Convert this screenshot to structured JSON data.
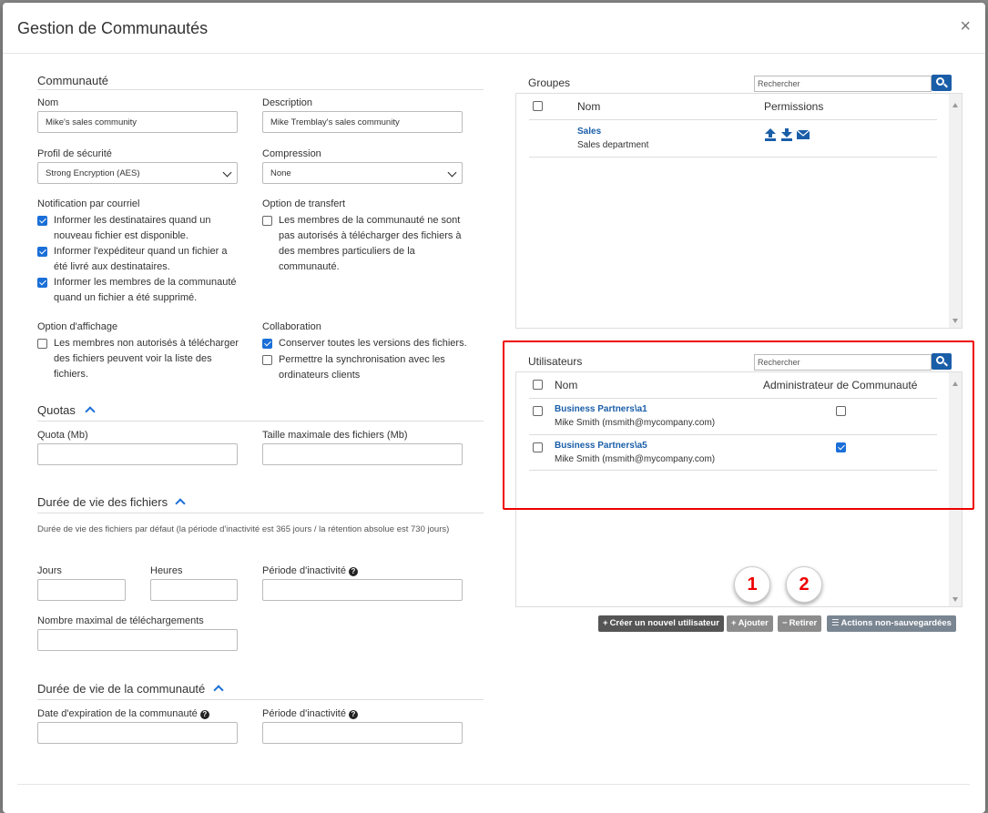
{
  "modal": {
    "title": "Gestion de Communautés",
    "close": "×"
  },
  "communaute": {
    "title": "Communauté",
    "nom_label": "Nom",
    "nom_value": "Mike's sales community",
    "desc_label": "Description",
    "desc_value": "Mike Tremblay's sales community",
    "profil_label": "Profil de sécurité",
    "profil_value": "Strong Encryption (AES)",
    "compression_label": "Compression",
    "compression_value": "None",
    "notif_label": "Notification par courriel",
    "notif_items": [
      {
        "text": "Informer les destinataires quand un nouveau fichier est disponible.",
        "checked": true
      },
      {
        "text": "Informer l'expéditeur quand un fichier a été livré aux destinataires.",
        "checked": true
      },
      {
        "text": "Informer les membres de la communauté quand un fichier a été supprimé.",
        "checked": true
      }
    ],
    "transfert_label": "Option de transfert",
    "transfert_text": "Les membres de la communauté ne sont pas autorisés à télécharger des fichiers à des membres particuliers de la communauté.",
    "affichage_label": "Option d'affichage",
    "affichage_text": "Les membres non autorisés à télécharger des fichiers peuvent voir la liste des fichiers.",
    "collab_label": "Collaboration",
    "collab_items": [
      {
        "text": "Conserver toutes les versions des fichiers.",
        "checked": true
      },
      {
        "text": "Permettre la synchronisation avec les ordinateurs clients",
        "checked": false
      }
    ]
  },
  "quotas": {
    "title": "Quotas",
    "quota_label": "Quota (Mb)",
    "taille_label": "Taille maximale des fichiers (Mb)"
  },
  "duree_fichiers": {
    "title": "Durée de vie des fichiers",
    "note": "Durée de vie des fichiers par défaut (la période d'inactivité est 365 jours / la rétention absolue est 730 jours)",
    "jours_label": "Jours",
    "heures_label": "Heures",
    "inactivite_label": "Période d'inactivité",
    "max_dl_label": "Nombre maximal de téléchargements"
  },
  "duree_communaute": {
    "title": "Durée de vie de la communauté",
    "expiration_label": "Date d'expiration de la communauté",
    "inactivite_label": "Période d'inactivité"
  },
  "groupes": {
    "title": "Groupes",
    "search_placeholder": "Rechercher",
    "col_nom": "Nom",
    "col_permissions": "Permissions",
    "rows": [
      {
        "name": "Sales",
        "desc": "Sales department"
      }
    ]
  },
  "utilisateurs": {
    "title": "Utilisateurs",
    "search_placeholder": "Rechercher",
    "col_nom": "Nom",
    "col_admin": "Administrateur de Communauté",
    "rows": [
      {
        "name": "Business Partners\\a1",
        "desc": "Mike Smith (msmith@mycompany.com)",
        "admin": false
      },
      {
        "name": "Business Partners\\a5",
        "desc": "Mike Smith (msmith@mycompany.com)",
        "admin": true
      }
    ]
  },
  "callouts": [
    "1",
    "2"
  ],
  "buttons": {
    "create": "Créer un nouvel utilisateur",
    "add": "Ajouter",
    "remove": "Retirer",
    "unsaved": "Actions non-sauvegardées"
  },
  "colors": {
    "accent": "#1a5ea8",
    "checkbox": "#1a6fd8",
    "highlight": "#e00000"
  },
  "icons": [
    "upload-icon",
    "download-icon",
    "envelope-icon",
    "search-icon",
    "chevron-up-icon",
    "help-icon",
    "plus-icon",
    "minus-icon",
    "list-icon"
  ]
}
